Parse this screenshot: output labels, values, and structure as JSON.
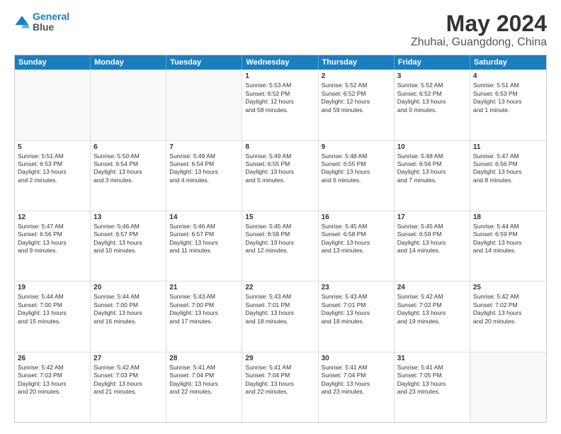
{
  "logo": {
    "line1": "General",
    "line2": "Blue"
  },
  "title": "May 2024",
  "subtitle": "Zhuhai, Guangdong, China",
  "header_days": [
    "Sunday",
    "Monday",
    "Tuesday",
    "Wednesday",
    "Thursday",
    "Friday",
    "Saturday"
  ],
  "weeks": [
    [
      {
        "day": "",
        "content": ""
      },
      {
        "day": "",
        "content": ""
      },
      {
        "day": "",
        "content": ""
      },
      {
        "day": "1",
        "content": "Sunrise: 5:53 AM\nSunset: 6:52 PM\nDaylight: 12 hours\nand 58 minutes."
      },
      {
        "day": "2",
        "content": "Sunrise: 5:52 AM\nSunset: 6:52 PM\nDaylight: 12 hours\nand 59 minutes."
      },
      {
        "day": "3",
        "content": "Sunrise: 5:52 AM\nSunset: 6:52 PM\nDaylight: 13 hours\nand 0 minutes."
      },
      {
        "day": "4",
        "content": "Sunrise: 5:51 AM\nSunset: 6:53 PM\nDaylight: 13 hours\nand 1 minute."
      }
    ],
    [
      {
        "day": "5",
        "content": "Sunrise: 5:51 AM\nSunset: 6:53 PM\nDaylight: 13 hours\nand 2 minutes."
      },
      {
        "day": "6",
        "content": "Sunrise: 5:50 AM\nSunset: 6:54 PM\nDaylight: 13 hours\nand 3 minutes."
      },
      {
        "day": "7",
        "content": "Sunrise: 5:49 AM\nSunset: 6:54 PM\nDaylight: 13 hours\nand 4 minutes."
      },
      {
        "day": "8",
        "content": "Sunrise: 5:49 AM\nSunset: 6:55 PM\nDaylight: 13 hours\nand 5 minutes."
      },
      {
        "day": "9",
        "content": "Sunrise: 5:48 AM\nSunset: 6:55 PM\nDaylight: 13 hours\nand 6 minutes."
      },
      {
        "day": "10",
        "content": "Sunrise: 5:48 AM\nSunset: 6:56 PM\nDaylight: 13 hours\nand 7 minutes."
      },
      {
        "day": "11",
        "content": "Sunrise: 5:47 AM\nSunset: 6:56 PM\nDaylight: 13 hours\nand 8 minutes."
      }
    ],
    [
      {
        "day": "12",
        "content": "Sunrise: 5:47 AM\nSunset: 6:56 PM\nDaylight: 13 hours\nand 9 minutes."
      },
      {
        "day": "13",
        "content": "Sunrise: 5:46 AM\nSunset: 6:57 PM\nDaylight: 13 hours\nand 10 minutes."
      },
      {
        "day": "14",
        "content": "Sunrise: 5:46 AM\nSunset: 6:57 PM\nDaylight: 13 hours\nand 11 minutes."
      },
      {
        "day": "15",
        "content": "Sunrise: 5:45 AM\nSunset: 6:58 PM\nDaylight: 13 hours\nand 12 minutes."
      },
      {
        "day": "16",
        "content": "Sunrise: 5:45 AM\nSunset: 6:58 PM\nDaylight: 13 hours\nand 13 minutes."
      },
      {
        "day": "17",
        "content": "Sunrise: 5:45 AM\nSunset: 6:59 PM\nDaylight: 13 hours\nand 14 minutes."
      },
      {
        "day": "18",
        "content": "Sunrise: 5:44 AM\nSunset: 6:59 PM\nDaylight: 13 hours\nand 14 minutes."
      }
    ],
    [
      {
        "day": "19",
        "content": "Sunrise: 5:44 AM\nSunset: 7:00 PM\nDaylight: 13 hours\nand 15 minutes."
      },
      {
        "day": "20",
        "content": "Sunrise: 5:44 AM\nSunset: 7:00 PM\nDaylight: 13 hours\nand 16 minutes."
      },
      {
        "day": "21",
        "content": "Sunrise: 5:43 AM\nSunset: 7:00 PM\nDaylight: 13 hours\nand 17 minutes."
      },
      {
        "day": "22",
        "content": "Sunrise: 5:43 AM\nSunset: 7:01 PM\nDaylight: 13 hours\nand 18 minutes."
      },
      {
        "day": "23",
        "content": "Sunrise: 5:43 AM\nSunset: 7:01 PM\nDaylight: 13 hours\nand 18 minutes."
      },
      {
        "day": "24",
        "content": "Sunrise: 5:42 AM\nSunset: 7:02 PM\nDaylight: 13 hours\nand 19 minutes."
      },
      {
        "day": "25",
        "content": "Sunrise: 5:42 AM\nSunset: 7:02 PM\nDaylight: 13 hours\nand 20 minutes."
      }
    ],
    [
      {
        "day": "26",
        "content": "Sunrise: 5:42 AM\nSunset: 7:03 PM\nDaylight: 13 hours\nand 20 minutes."
      },
      {
        "day": "27",
        "content": "Sunrise: 5:42 AM\nSunset: 7:03 PM\nDaylight: 13 hours\nand 21 minutes."
      },
      {
        "day": "28",
        "content": "Sunrise: 5:41 AM\nSunset: 7:04 PM\nDaylight: 13 hours\nand 22 minutes."
      },
      {
        "day": "29",
        "content": "Sunrise: 5:41 AM\nSunset: 7:04 PM\nDaylight: 13 hours\nand 22 minutes."
      },
      {
        "day": "30",
        "content": "Sunrise: 5:41 AM\nSunset: 7:04 PM\nDaylight: 13 hours\nand 23 minutes."
      },
      {
        "day": "31",
        "content": "Sunrise: 5:41 AM\nSunset: 7:05 PM\nDaylight: 13 hours\nand 23 minutes."
      },
      {
        "day": "",
        "content": ""
      }
    ]
  ]
}
